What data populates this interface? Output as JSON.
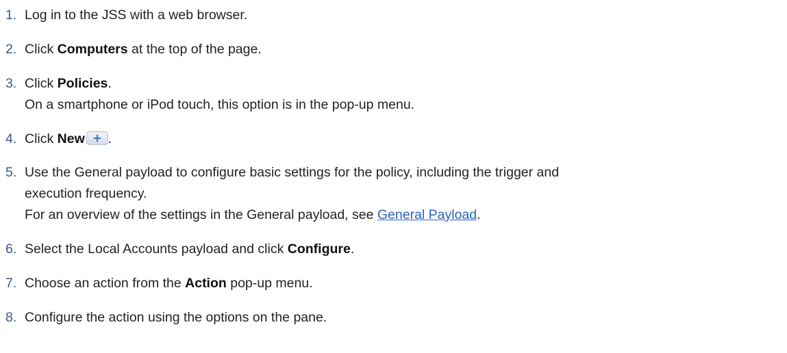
{
  "steps": [
    {
      "number": "1.",
      "text": "Log in to the JSS with a web browser."
    },
    {
      "number": "2.",
      "prefix": "Click ",
      "bold": "Computers",
      "suffix": " at the top of the page."
    },
    {
      "number": "3.",
      "prefix": "Click ",
      "bold": "Policies",
      "suffix": ".",
      "note": "On a smartphone or iPod touch, this option is in the pop-up menu."
    },
    {
      "number": "4.",
      "prefix": "Click ",
      "bold": "New",
      "icon": "plus-icon",
      "suffix": "."
    },
    {
      "number": "5.",
      "line1": "Use the General payload to configure basic settings for the policy, including the trigger and",
      "line2": "execution frequency.",
      "note_prefix": "For an overview of the settings in the General payload, see ",
      "note_link": "General Payload",
      "note_suffix": "."
    },
    {
      "number": "6.",
      "prefix": "Select the Local Accounts payload and click ",
      "bold": "Configure",
      "suffix": "."
    },
    {
      "number": "7.",
      "prefix": "Choose an action from the ",
      "bold": "Action",
      "suffix": " pop-up menu."
    },
    {
      "number": "8.",
      "text": "Configure the action using the options on the pane."
    }
  ],
  "colors": {
    "number": "#3a5a8a",
    "link": "#2a64b6",
    "button_bg": "#dde3ec",
    "button_plus": "#3c70c8"
  }
}
